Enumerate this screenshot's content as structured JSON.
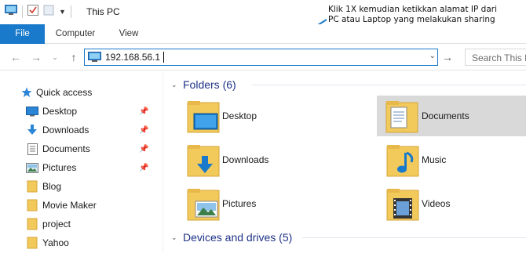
{
  "titlebar": {
    "title": "This PC"
  },
  "annotation": {
    "text": "Klik 1X kemudian ketikkan alamat IP dari PC atau Laptop yang melakukan sharing printer."
  },
  "ribbon": {
    "tabs": [
      {
        "label": "File"
      },
      {
        "label": "Computer"
      },
      {
        "label": "View"
      }
    ]
  },
  "address": {
    "value": "192.168.56.1"
  },
  "search": {
    "placeholder": "Search This PC"
  },
  "nav": {
    "quick_access": "Quick access",
    "items": [
      {
        "label": "Desktop",
        "icon": "desktop-icon",
        "pinned": true
      },
      {
        "label": "Downloads",
        "icon": "download-icon",
        "pinned": true
      },
      {
        "label": "Documents",
        "icon": "documents-icon",
        "pinned": true
      },
      {
        "label": "Pictures",
        "icon": "pictures-icon",
        "pinned": true
      },
      {
        "label": "Blog",
        "icon": "folder-icon",
        "pinned": false
      },
      {
        "label": "Movie Maker",
        "icon": "folder-icon",
        "pinned": false
      },
      {
        "label": "project",
        "icon": "folder-icon",
        "pinned": false
      },
      {
        "label": "Yahoo",
        "icon": "folder-icon",
        "pinned": false
      }
    ]
  },
  "main": {
    "folders_header": "Folders (6)",
    "folders": [
      {
        "label": "Desktop",
        "icon": "desktop-folder-icon"
      },
      {
        "label": "Documents",
        "icon": "documents-folder-icon",
        "selected": true
      },
      {
        "label": "Downloads",
        "icon": "downloads-folder-icon"
      },
      {
        "label": "Music",
        "icon": "music-folder-icon"
      },
      {
        "label": "Pictures",
        "icon": "pictures-folder-icon"
      },
      {
        "label": "Videos",
        "icon": "videos-folder-icon"
      }
    ],
    "devices_header": "Devices and drives (5)"
  },
  "colors": {
    "accent": "#1979ca",
    "group_title": "#1e3287",
    "selected_bg": "#d9d9d9",
    "folder": "#f2c95b"
  }
}
